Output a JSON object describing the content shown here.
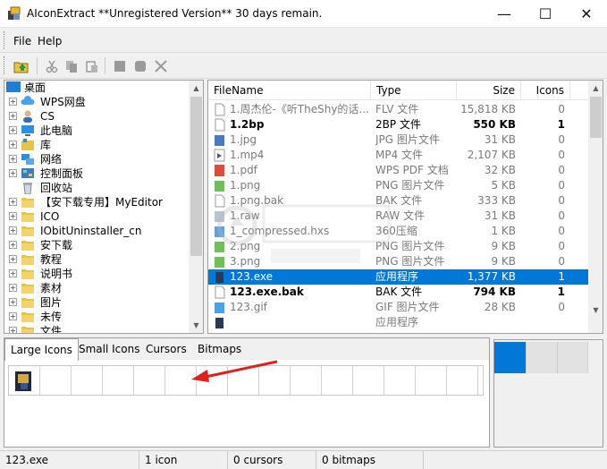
{
  "window": {
    "title": "AIconExtract  **Unregistered Version** 30 days remain.",
    "minimize_glyph": "—",
    "maximize_glyph": "☐",
    "close_glyph": "✕"
  },
  "menu": {
    "file": "File",
    "help": "Help"
  },
  "toolbar": {
    "icons": [
      "open-folder-icon",
      "cut-icon",
      "copy-icon",
      "paste-icon",
      "stop-icon",
      "stop-all-icon",
      "delete-icon"
    ]
  },
  "tree": {
    "root": "桌面",
    "items": [
      {
        "label": "WPS网盘",
        "icon": "cloud-icon",
        "expandable": true
      },
      {
        "label": "CS",
        "icon": "user-icon",
        "expandable": true
      },
      {
        "label": "此电脑",
        "icon": "computer-icon",
        "expandable": true
      },
      {
        "label": "库",
        "icon": "library-icon",
        "expandable": true
      },
      {
        "label": "网络",
        "icon": "network-icon",
        "expandable": true
      },
      {
        "label": "控制面板",
        "icon": "control-panel-icon",
        "expandable": true
      },
      {
        "label": "回收站",
        "icon": "recycle-bin-icon",
        "expandable": false
      },
      {
        "label": "【安下载专用】MyEditor",
        "icon": "folder-icon",
        "expandable": true
      },
      {
        "label": "ICO",
        "icon": "folder-icon",
        "expandable": true
      },
      {
        "label": "IObitUninstaller_cn",
        "icon": "folder-icon",
        "expandable": true
      },
      {
        "label": "安下载",
        "icon": "folder-icon",
        "expandable": true
      },
      {
        "label": "教程",
        "icon": "folder-icon",
        "expandable": true
      },
      {
        "label": "说明书",
        "icon": "folder-icon",
        "expandable": true
      },
      {
        "label": "素材",
        "icon": "folder-icon",
        "expandable": true
      },
      {
        "label": "图片",
        "icon": "folder-icon",
        "expandable": true
      },
      {
        "label": "未传",
        "icon": "folder-icon",
        "expandable": true
      },
      {
        "label": "文件",
        "icon": "folder-icon",
        "expandable": true
      }
    ]
  },
  "list": {
    "columns": [
      "FileName",
      "Type",
      "Size",
      "Icons"
    ],
    "rows": [
      {
        "name": "1.周杰伦-《听TheShy的话...",
        "type": "FLV 文件",
        "size": "15,818 KB",
        "icons": "0",
        "icon": "file-icon",
        "dim": true,
        "selected": false
      },
      {
        "name": "1.2bp",
        "type": "2BP 文件",
        "size": "550 KB",
        "icons": "1",
        "icon": "file-icon",
        "dim": false,
        "selected": false
      },
      {
        "name": "1.jpg",
        "type": "JPG 图片文件",
        "size": "31 KB",
        "icons": "0",
        "icon": "jpg-file-icon",
        "dim": true,
        "selected": false
      },
      {
        "name": "1.mp4",
        "type": "MP4 文件",
        "size": "2,107 KB",
        "icons": "0",
        "icon": "video-file-icon",
        "dim": true,
        "selected": false
      },
      {
        "name": "1.pdf",
        "type": "WPS PDF 文档",
        "size": "32 KB",
        "icons": "0",
        "icon": "pdf-file-icon",
        "dim": true,
        "selected": false
      },
      {
        "name": "1.png",
        "type": "PNG 图片文件",
        "size": "5 KB",
        "icons": "0",
        "icon": "png-file-icon",
        "dim": true,
        "selected": false
      },
      {
        "name": "1.png.bak",
        "type": "BAK 文件",
        "size": "333 KB",
        "icons": "0",
        "icon": "file-icon",
        "dim": true,
        "selected": false
      },
      {
        "name": "1.raw",
        "type": "RAW 文件",
        "size": "31 KB",
        "icons": "0",
        "icon": "image-file-icon",
        "dim": true,
        "selected": false
      },
      {
        "name": "1_compressed.hxs",
        "type": "360压缩",
        "size": "1 KB",
        "icons": "0",
        "icon": "archive-file-icon",
        "dim": true,
        "selected": false
      },
      {
        "name": "2.png",
        "type": "PNG 图片文件",
        "size": "9 KB",
        "icons": "0",
        "icon": "png-file-icon",
        "dim": true,
        "selected": false
      },
      {
        "name": "3.png",
        "type": "PNG 图片文件",
        "size": "9 KB",
        "icons": "0",
        "icon": "png-file-icon",
        "dim": true,
        "selected": false
      },
      {
        "name": "123.exe",
        "type": "应用程序",
        "size": "1,377 KB",
        "icons": "1",
        "icon": "exe-file-icon",
        "dim": false,
        "selected": true
      },
      {
        "name": "123.exe.bak",
        "type": "BAK 文件",
        "size": "794 KB",
        "icons": "1",
        "icon": "file-icon",
        "dim": false,
        "selected": false
      },
      {
        "name": "123.gif",
        "type": "GIF 图片文件",
        "size": "28 KB",
        "icons": "0",
        "icon": "gif-file-icon",
        "dim": true,
        "selected": false
      },
      {
        "name": "",
        "type": "应用程序",
        "size": "",
        "icons": "",
        "icon": "exe-file-icon",
        "dim": true,
        "selected": false
      }
    ]
  },
  "tabs": {
    "items": [
      "Large Icons",
      "Small Icons",
      "Cursors",
      "Bitmaps"
    ],
    "active": 0
  },
  "colors": {
    "selection": "#0078d7",
    "annotation_arrow": "#e0201c"
  },
  "status": {
    "file": "123.exe",
    "icons": "1 icon",
    "cursors": "0 cursors",
    "bitmaps": "0 bitmaps"
  }
}
